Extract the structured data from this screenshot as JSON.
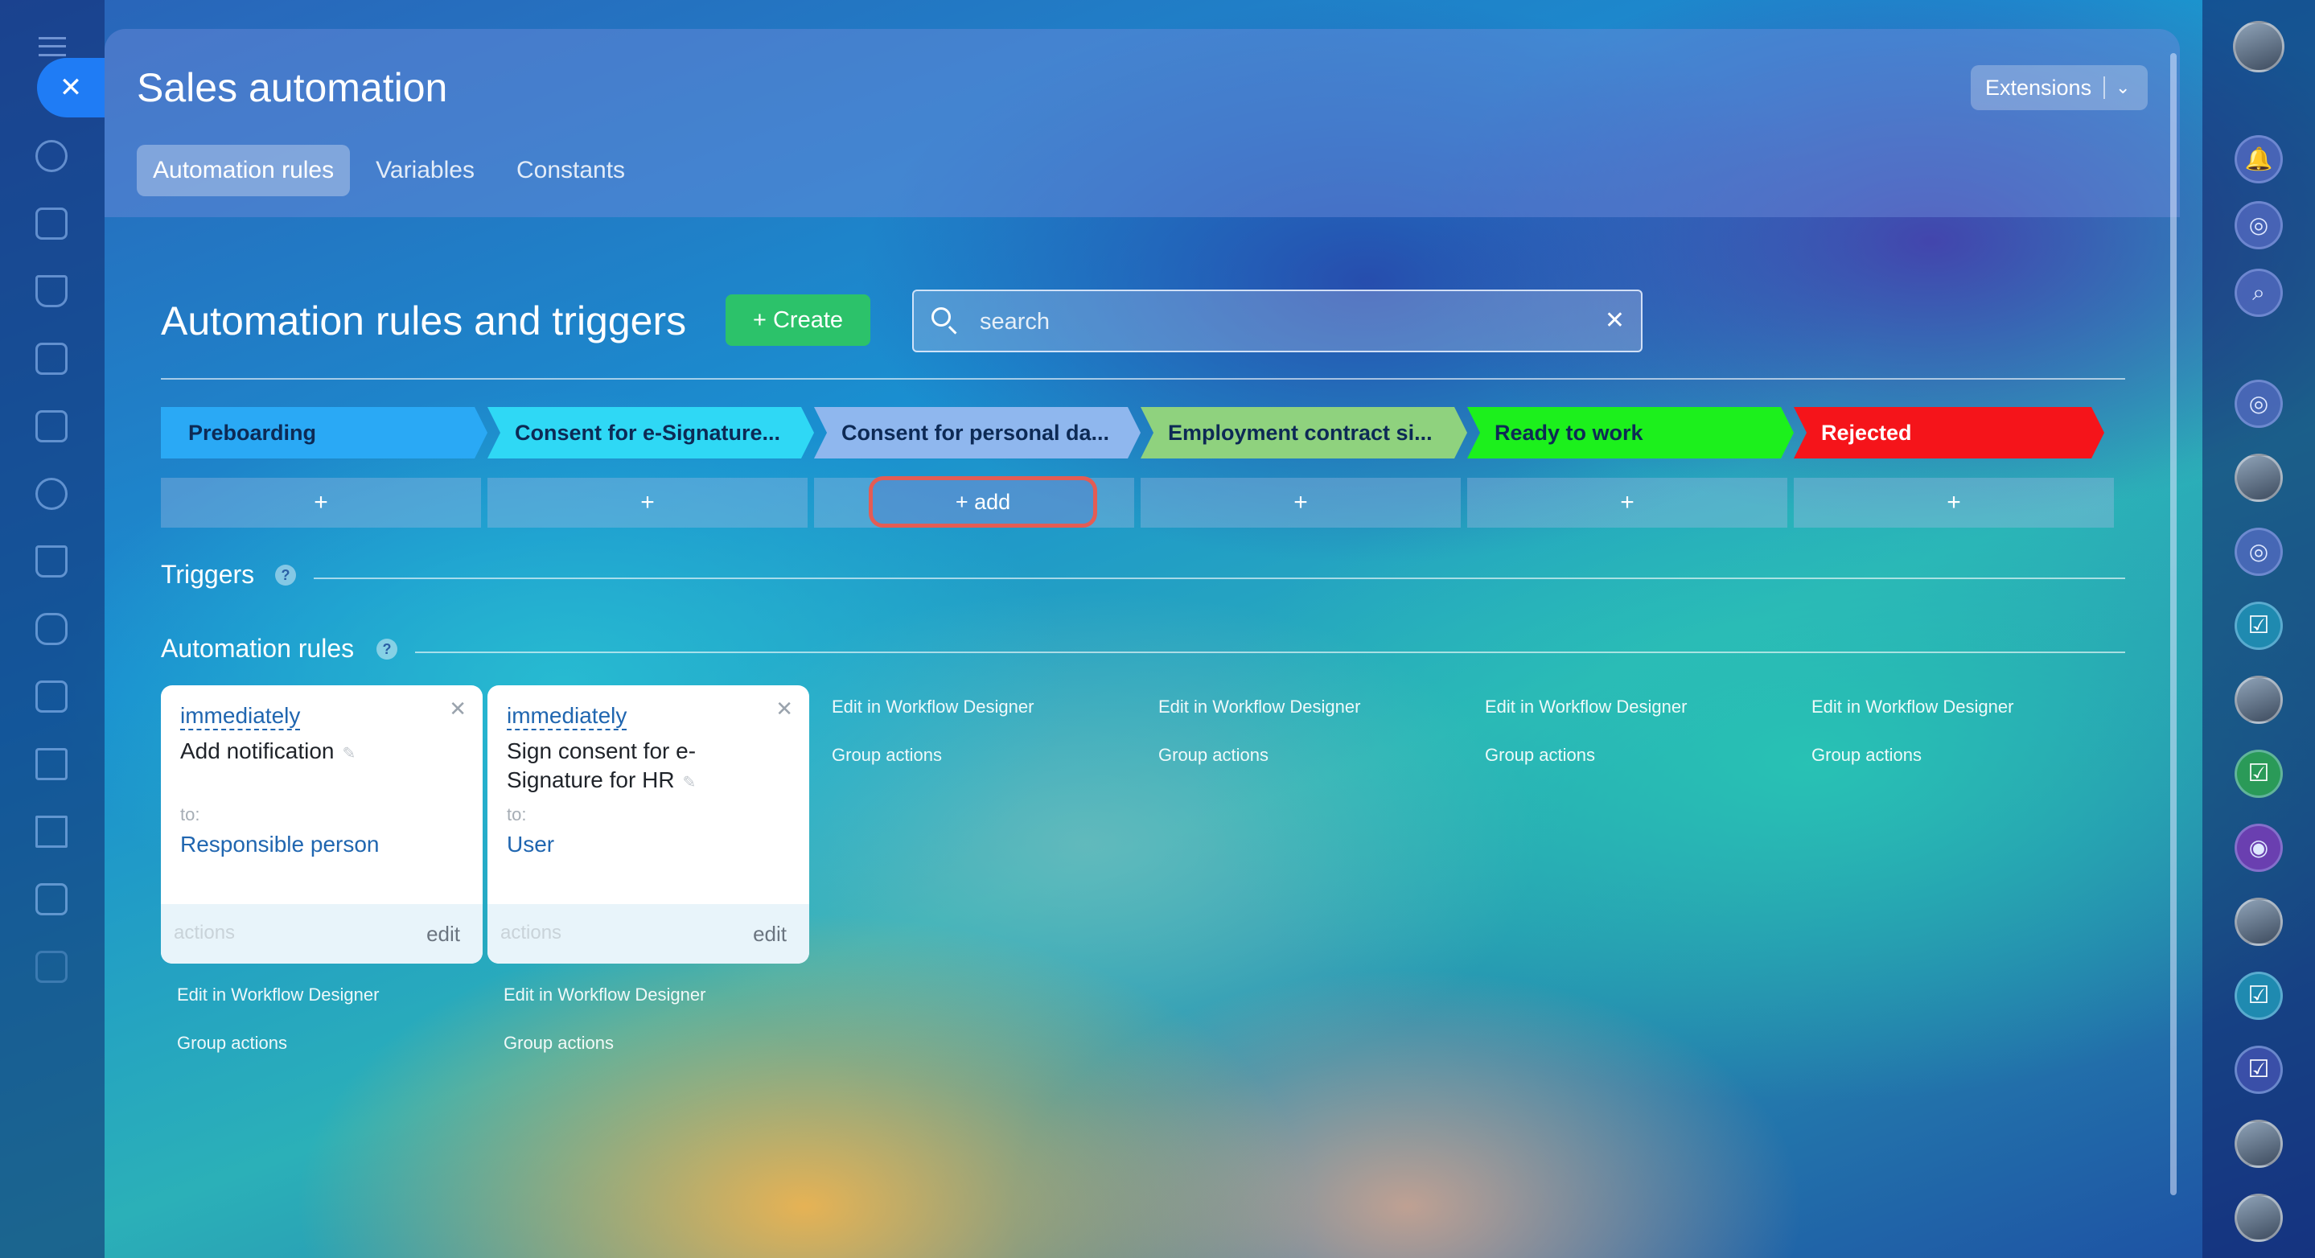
{
  "window": {
    "title": "Sales automation",
    "tabs": [
      {
        "label": "Automation rules",
        "active": true
      },
      {
        "label": "Variables",
        "active": false
      },
      {
        "label": "Constants",
        "active": false
      }
    ],
    "extensions_label": "Extensions"
  },
  "main": {
    "heading": "Automation rules and triggers",
    "create_label": "Create",
    "search_placeholder": "search",
    "stages": [
      {
        "label": "Preboarding",
        "color": "#2aa9f5",
        "text_color": "#0d2a55"
      },
      {
        "label": "Consent for e-Signature...",
        "color": "#2fd8f5",
        "text_color": "#0d2a55"
      },
      {
        "label": "Consent for personal da...",
        "color": "#8fb7ee",
        "text_color": "#0d2a55"
      },
      {
        "label": "Employment contract si...",
        "color": "#8fd27e",
        "text_color": "#0d2a55"
      },
      {
        "label": "Ready to work",
        "color": "#1cf01c",
        "text_color": "#0d2a55"
      },
      {
        "label": "Rejected",
        "color": "#f5141a",
        "text_color": "#ffffff"
      }
    ],
    "add_plus": "+",
    "add_highlight_label": "+ add",
    "triggers_label": "Triggers",
    "rules_label": "Automation rules",
    "help_mark": "?",
    "cards": [
      {
        "when": "immediately",
        "name": "Add notification",
        "to_label": "to:",
        "target": "Responsible person",
        "actions": "actions",
        "edit": "edit"
      },
      {
        "when": "immediately",
        "name": "Sign consent for e-Signature for HR",
        "to_label": "to:",
        "target": "User",
        "actions": "actions",
        "edit": "edit"
      }
    ],
    "links": {
      "workflow": "Edit in Workflow Designer",
      "group": "Group actions"
    }
  },
  "icons": {
    "close": "close-icon",
    "search": "search-icon",
    "clear": "clear-icon",
    "plus": "plus-icon",
    "chevron": "chevron-down-icon",
    "pencil": "pencil-icon",
    "help": "help-icon"
  },
  "colors": {
    "create_button": "#2cc26a",
    "highlight": "#e45c54",
    "link": "#2066b0"
  }
}
